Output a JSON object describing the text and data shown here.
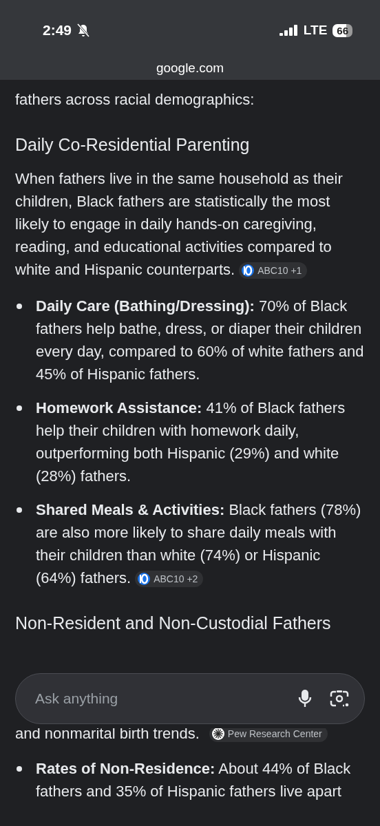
{
  "status_bar": {
    "time": "2:49",
    "network": "LTE",
    "battery": "66"
  },
  "address_bar": {
    "url": "google.com"
  },
  "intro": {
    "text": "fathers across racial demographics:"
  },
  "sections": [
    {
      "heading": "Daily Co-Residential Parenting",
      "paragraph": "When fathers live in the same household as their children, Black fathers are statistically the most likely to engage in daily hands-on caregiving, reading, and educational activities compared to white and Hispanic counterparts.",
      "citation": "ABC10 +1",
      "bullets": [
        {
          "term": "Daily Care (Bathing/Dressing):",
          "text": "70% of Black fathers help bathe, dress, or diaper their children every day, compared to 60% of white fathers and 45% of Hispanic fathers."
        },
        {
          "term": "Homework Assistance:",
          "text": "41% of Black fathers help their children with homework daily, outperforming both Hispanic (29%) and white (28%) fathers."
        },
        {
          "term": "Shared Meals & Activities:",
          "text": "Black fathers (78%) are also more likely to share daily meals with their children than white (74%) or Hispanic (64%) fathers.",
          "citation": "ABC10 +2"
        }
      ]
    },
    {
      "heading": "Non-Resident and Non-Custodial Fathers"
    }
  ],
  "search_bar": {
    "placeholder": "Ask anything"
  },
  "after_search": {
    "cut_line": "and nonmarital birth trends.",
    "citation": "Pew Research Center",
    "bullets": [
      {
        "term": "Rates of Non-Residence:",
        "text": "About 44% of Black fathers and 35% of Hispanic fathers live apart"
      }
    ]
  }
}
